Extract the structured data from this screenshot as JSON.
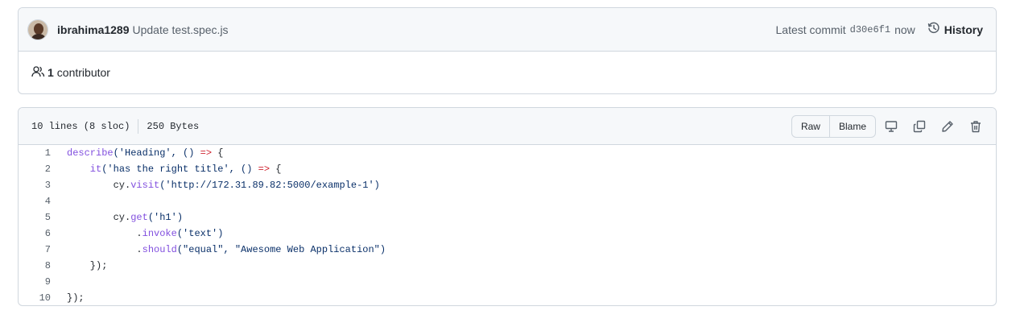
{
  "commit": {
    "author": "ibrahima1289",
    "message": "Update test.spec.js",
    "latest_label": "Latest commit",
    "sha": "d30e6f1",
    "when": "now",
    "history_label": "History",
    "contributor_count": "1",
    "contributor_word": "contributor"
  },
  "file": {
    "lines_info": "10 lines (8 sloc)",
    "size_info": "250 Bytes",
    "raw_label": "Raw",
    "blame_label": "Blame",
    "icons": [
      "display-icon",
      "copy-icon",
      "pencil-icon",
      "trash-icon"
    ]
  },
  "code": [
    {
      "n": "1",
      "parts": [
        {
          "t": "describe",
          "c": "fn"
        },
        {
          "t": "('Heading', () ",
          "c": "str"
        },
        {
          "t": "=>",
          "c": "kw"
        },
        {
          "t": " {",
          "c": ""
        }
      ]
    },
    {
      "n": "2",
      "parts": [
        {
          "t": "    it",
          "c": "fn"
        },
        {
          "t": "('has the right title', () ",
          "c": "str"
        },
        {
          "t": "=>",
          "c": "kw"
        },
        {
          "t": " {",
          "c": ""
        }
      ]
    },
    {
      "n": "3",
      "parts": [
        {
          "t": "        cy.",
          "c": ""
        },
        {
          "t": "visit",
          "c": "fn"
        },
        {
          "t": "('http://172.31.89.82:5000/example-1')",
          "c": "str"
        }
      ]
    },
    {
      "n": "4",
      "parts": [
        {
          "t": "",
          "c": ""
        }
      ]
    },
    {
      "n": "5",
      "parts": [
        {
          "t": "        cy.",
          "c": ""
        },
        {
          "t": "get",
          "c": "fn"
        },
        {
          "t": "('h1')",
          "c": "str"
        }
      ]
    },
    {
      "n": "6",
      "parts": [
        {
          "t": "            .",
          "c": ""
        },
        {
          "t": "invoke",
          "c": "fn"
        },
        {
          "t": "('text')",
          "c": "str"
        }
      ]
    },
    {
      "n": "7",
      "parts": [
        {
          "t": "            .",
          "c": ""
        },
        {
          "t": "should",
          "c": "fn"
        },
        {
          "t": "(\"equal\", \"Awesome Web Application\")",
          "c": "str"
        }
      ]
    },
    {
      "n": "8",
      "parts": [
        {
          "t": "    });",
          "c": ""
        }
      ]
    },
    {
      "n": "9",
      "parts": [
        {
          "t": "",
          "c": ""
        }
      ]
    },
    {
      "n": "10",
      "parts": [
        {
          "t": "});",
          "c": ""
        }
      ]
    }
  ]
}
